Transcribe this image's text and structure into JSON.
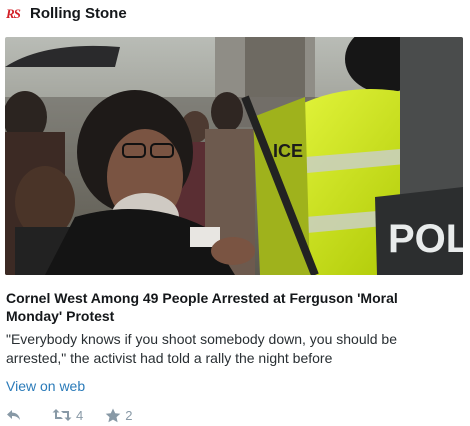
{
  "source": {
    "logo_icon": "rolling-stone-logo",
    "logo_text": "RS",
    "logo_color": "#d32027",
    "name": "Rolling Stone"
  },
  "card": {
    "headline": "Cornel West Among 49 People Arrested at Ferguson 'Moral Monday' Protest",
    "summary": "\"Everybody knows if you shoot somebody down, you should be arrested,\" the activist had told a rally the night before",
    "link_label": "View on web"
  },
  "actions": {
    "reply_icon": "reply-icon",
    "retweet_icon": "retweet-icon",
    "retweet_count": "4",
    "favorite_icon": "star-icon",
    "favorite_count": "2"
  },
  "colors": {
    "link": "#2b7bb9",
    "muted_icon": "#8899a6",
    "police_vest": "#c8e600"
  }
}
